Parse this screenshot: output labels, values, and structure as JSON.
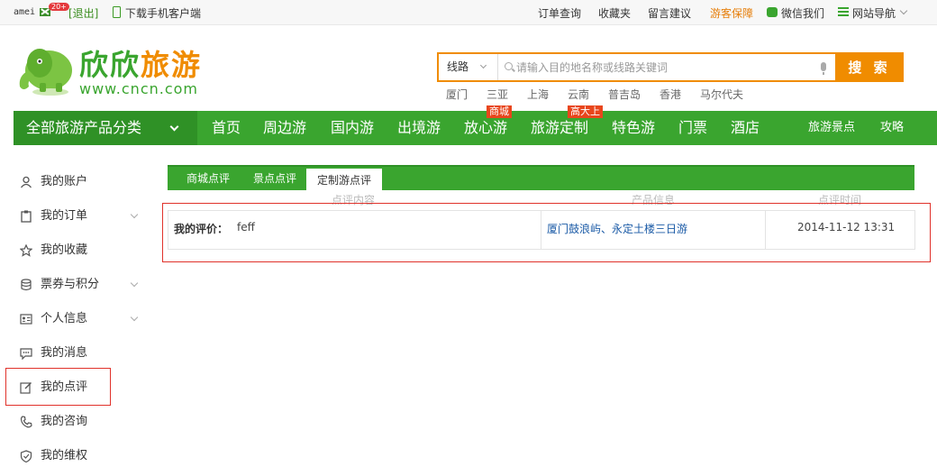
{
  "topbar": {
    "username": "amei",
    "mail_badge": "20+",
    "logout": "[退出]",
    "download_app": "下载手机客户端",
    "links": [
      "订单查询",
      "收藏夹",
      "留言建议",
      "游客保障",
      "微信我们",
      "网站导航"
    ]
  },
  "header": {
    "logo_text_part1": "欣欣",
    "logo_text_part2": "旅游",
    "logo_url": "www.cncn.com",
    "search": {
      "type": "线路",
      "placeholder": "请输入目的地名称或线路关键词",
      "button": "搜 索"
    },
    "hot_destinations": [
      "厦门",
      "三亚",
      "上海",
      "云南",
      "普吉岛",
      "香港",
      "马尔代夫"
    ]
  },
  "nav": {
    "all_categories": "全部旅游产品分类",
    "items": [
      "首页",
      "周边游",
      "国内游",
      "出境游",
      "放心游",
      "旅游定制",
      "特色游",
      "门票",
      "酒店"
    ],
    "tags": {
      "fangxin": "商城",
      "dingzhi": "高大上"
    },
    "right_items": [
      "旅游景点",
      "攻略"
    ]
  },
  "sidebar": {
    "items": [
      "我的账户",
      "我的订单",
      "我的收藏",
      "票券与积分",
      "个人信息",
      "我的消息",
      "我的点评",
      "我的咨询",
      "我的维权"
    ]
  },
  "tabs": [
    "商城点评",
    "景点点评",
    "定制游点评"
  ],
  "table": {
    "headers": [
      "点评内容",
      "产品信息",
      "点评时间"
    ],
    "rows": [
      {
        "label": "我的评价：",
        "content": "feff",
        "product": "厦门鼓浪屿、永定土楼三日游",
        "time": "2014-11-12 13:31"
      }
    ]
  },
  "colors": {
    "brand_green": "#3aa52f",
    "dark_green": "#2f9126",
    "accent_orange": "#f08c00",
    "highlight_red": "#e0322b",
    "link_blue": "#1a5aa6"
  }
}
